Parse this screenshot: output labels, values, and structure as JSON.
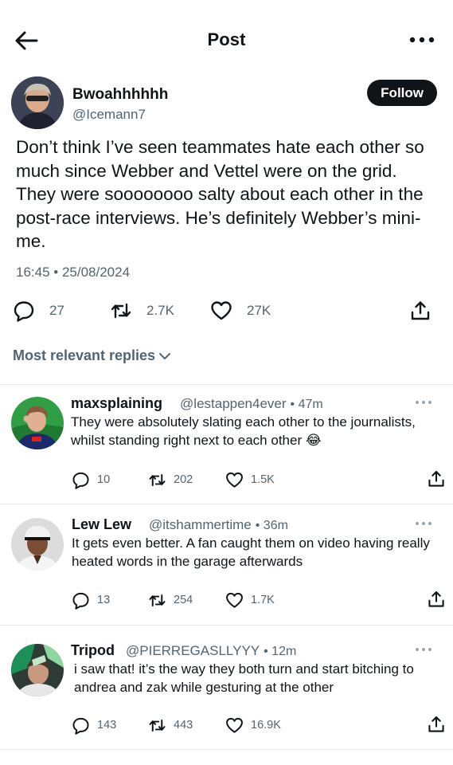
{
  "header": {
    "title": "Post",
    "back_icon": "arrow-left-icon",
    "more_icon": "more-horizontal-icon"
  },
  "post": {
    "author_name": "Bwoahhhhhh",
    "author_handle": "@Icemann7",
    "follow_label": "Follow",
    "text": "Don’t think I’ve seen teammates hate each other so much since Webber and Vettel were on the grid. They were soooooooo salty about each other in the post-race interviews. He’s definitely Webber’s mini-me.",
    "timestamp": "16:45 • 25/08/2024",
    "stats": {
      "replies": "27",
      "reposts": "2.7K",
      "likes": "27K"
    }
  },
  "sort": {
    "label": "Most relevant replies"
  },
  "replies": [
    {
      "name": "maxsplaining",
      "handle": "@lestappen4ever",
      "time": "• 47m",
      "text": "They were absolutely slating each other to the journalists, whilst standing right next to each other 😂",
      "replies": "10",
      "reposts": "202",
      "likes": "1.5K"
    },
    {
      "name": "Lew Lew",
      "handle": "@itshammertime",
      "time": "• 36m",
      "text": "It gets even better. A fan caught them on video having really heated words in the garage afterwards",
      "replies": "13",
      "reposts": "254",
      "likes": "1.7K"
    },
    {
      "name": "Tripod",
      "handle": "@PIERREGASLLYYY",
      "time": "• 12m",
      "text": "i saw that! it’s the way they both turn and start bitching to andrea and zak while gesturing at the other",
      "replies": "143",
      "reposts": "443",
      "likes": "16.9K"
    }
  ],
  "colors": {
    "text_primary": "#0f1419",
    "text_secondary": "#536471",
    "divider": "#e6e9ec",
    "follow_bg": "#0f1419"
  }
}
